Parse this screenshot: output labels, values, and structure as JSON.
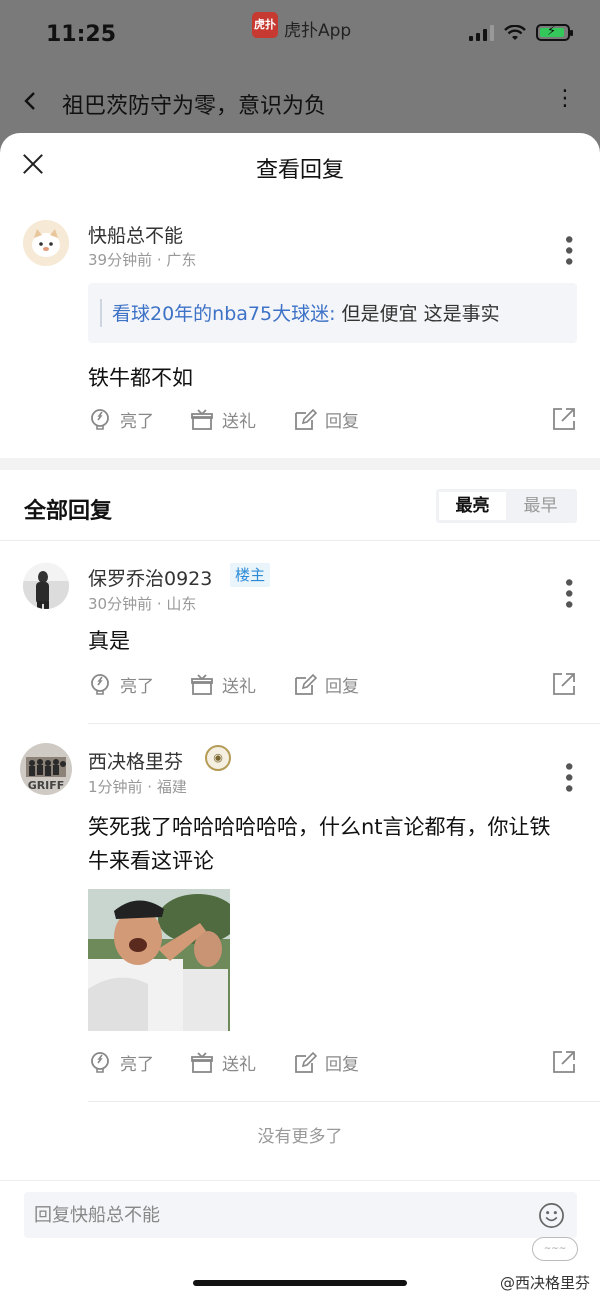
{
  "status_bar": {
    "time": "11:25",
    "app_name": "虎扑App",
    "app_badge": "虎扑"
  },
  "top_nav": {
    "title": "祖巴茨防守为零，意识为负"
  },
  "sheet": {
    "title": "查看回复"
  },
  "main_post": {
    "username": "快船总不能",
    "meta": "39分钟前 · 广东",
    "quote_author": "看球20年的nba75大球迷:",
    "quote_text": " 但是便宜 这是事实",
    "content": "铁牛都不如"
  },
  "actions": {
    "like": "亮了",
    "gift": "送礼",
    "reply": "回复"
  },
  "replies_section": {
    "title": "全部回复",
    "sort_options": [
      "最亮",
      "最早"
    ]
  },
  "replies": [
    {
      "username": "保罗乔治0923",
      "tag": "楼主",
      "meta": "30分钟前 · 山东",
      "content": "真是"
    },
    {
      "username": "西决格里芬",
      "meta": "1分钟前 · 福建",
      "content": "笑死我了哈哈哈哈哈哈，什么nt言论都有，你让铁牛来看这评论"
    }
  ],
  "end_text": "没有更多了",
  "reply_bar": {
    "placeholder": "回复快船总不能"
  },
  "watermark": "@西决格里芬",
  "colors": {
    "link_blue": "#3e72c7",
    "tag_blue": "#2d8bd6",
    "badge_red": "#c63a31"
  }
}
